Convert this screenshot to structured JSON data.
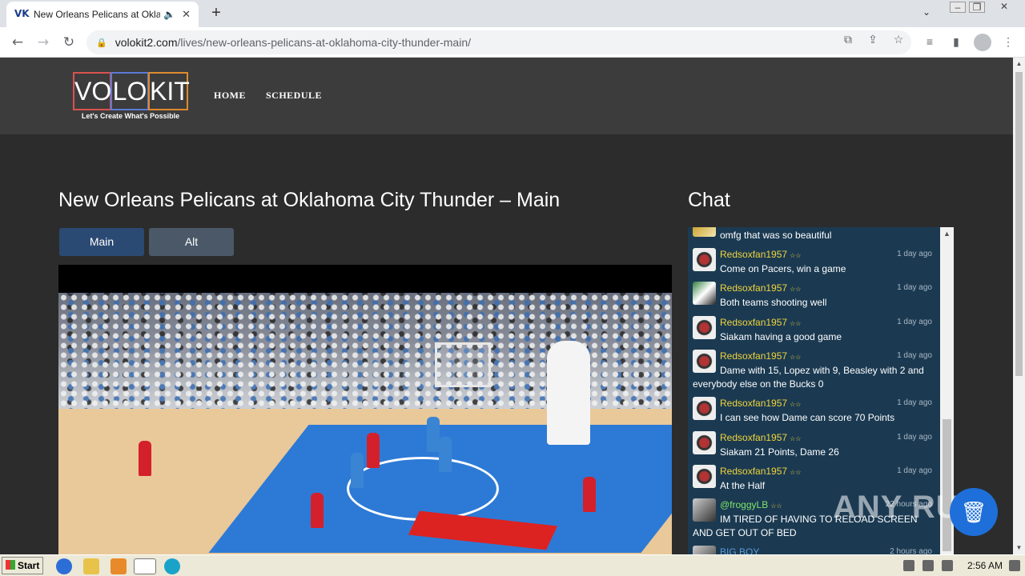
{
  "browser": {
    "tab_title": "New Orleans Pelicans at Oklaho",
    "url_host": "volokit2.com",
    "url_path": "/lives/new-orleans-pelicans-at-oklahoma-city-thunder-main/"
  },
  "site": {
    "logo_letters": [
      "VO",
      "LO",
      "KIT"
    ],
    "logo_tagline": "Let's Create What's Possible",
    "nav": [
      "HOME",
      "SCHEDULE"
    ]
  },
  "page": {
    "title": "New Orleans Pelicans at Oklahoma City Thunder – Main",
    "stream_buttons": [
      "Main",
      "Alt"
    ]
  },
  "chat": {
    "title": "Chat",
    "messages": [
      {
        "user": "",
        "stars": "",
        "time": "",
        "text": "omfg that was so beautiful"
      },
      {
        "user": "Redsoxfan1957",
        "stars": "☆☆",
        "time": "1 day ago",
        "text": "Come on Pacers, win a game"
      },
      {
        "user": "Redsoxfan1957",
        "stars": "☆☆",
        "time": "1 day ago",
        "text": "Both teams shooting well"
      },
      {
        "user": "Redsoxfan1957",
        "stars": "☆☆",
        "time": "1 day ago",
        "text": "Siakam having a good game"
      },
      {
        "user": "Redsoxfan1957",
        "stars": "☆☆",
        "time": "1 day ago",
        "text": "Dame with 15, Lopez with 9, Beasley with 2 and everybody else on the Bucks 0"
      },
      {
        "user": "Redsoxfan1957",
        "stars": "☆☆",
        "time": "1 day ago",
        "text": "I can see how Dame can score 70 Points"
      },
      {
        "user": "Redsoxfan1957",
        "stars": "☆☆",
        "time": "1 day ago",
        "text": "Siakam 21 Points, Dame 26"
      },
      {
        "user": "Redsoxfan1957",
        "stars": "☆☆",
        "time": "1 day ago",
        "text": "At the Half"
      },
      {
        "user": "@froggyLB",
        "stars": "☆☆",
        "time": "22 hours ago",
        "text": "IM TIRED OF HAVING TO RELOAD SCREEN AND GET OUT OF BED"
      },
      {
        "user": "BIG BOY",
        "stars": "",
        "time": "2 hours ago",
        "text": ""
      }
    ]
  },
  "watermark": "ANY  RUN",
  "taskbar": {
    "start_label": "Start",
    "clock": "2:56 AM"
  },
  "colors": {
    "header_bg": "#3c3c3c",
    "page_bg": "#2c2c2c",
    "chat_bg": "#1b3a52",
    "main_button": "#2b4a73",
    "alt_button": "#4a5868",
    "username": "#f0d43a"
  },
  "icons": {
    "back": "back-arrow-icon",
    "forward": "forward-arrow-icon",
    "reload": "reload-icon",
    "lock": "lock-icon",
    "star": "bookmark-star-icon",
    "share": "share-icon"
  }
}
